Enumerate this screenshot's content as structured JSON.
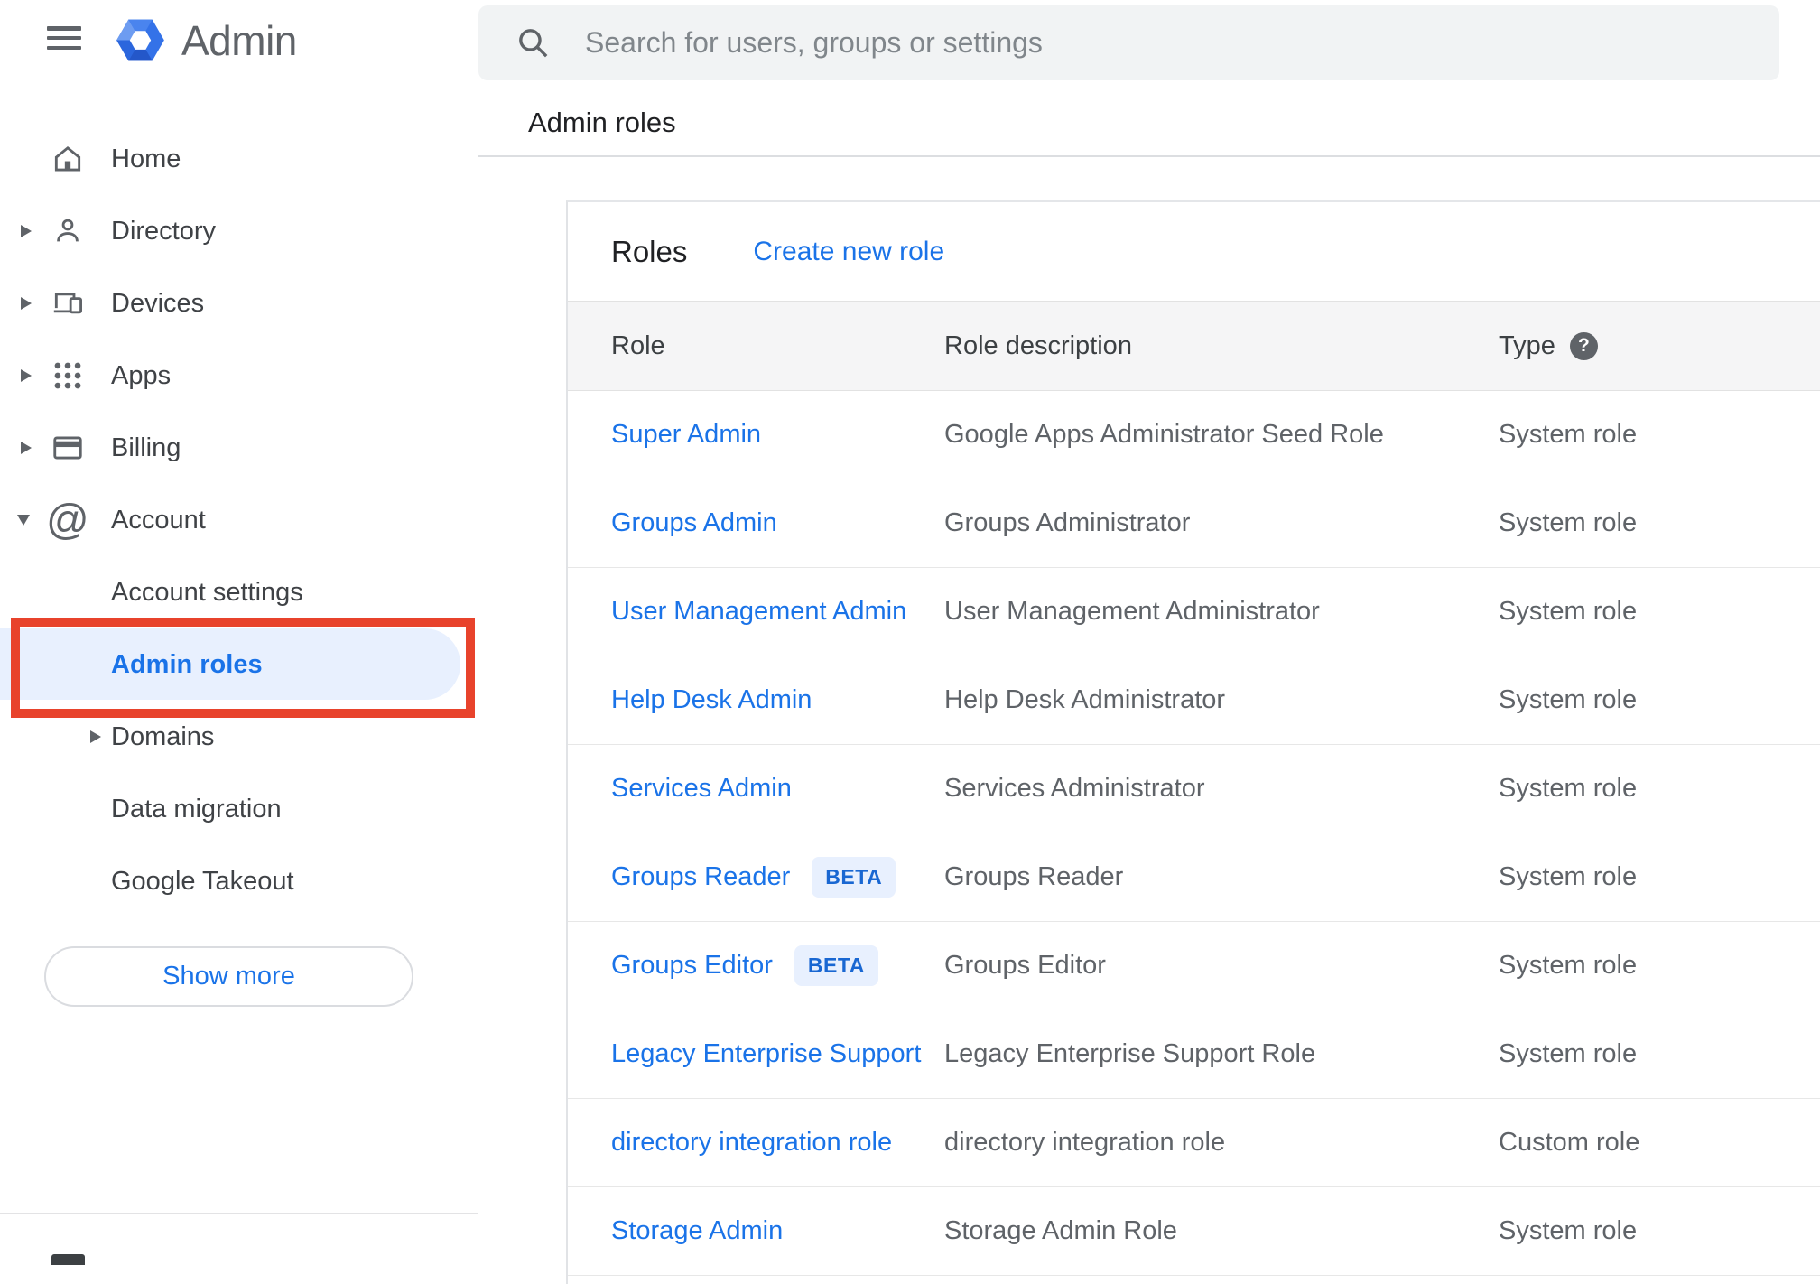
{
  "app": {
    "logo_text": "Admin"
  },
  "search": {
    "placeholder": "Search for users, groups or settings"
  },
  "breadcrumb": {
    "label": "Admin roles"
  },
  "sidebar": {
    "items": [
      {
        "label": "Home"
      },
      {
        "label": "Directory"
      },
      {
        "label": "Devices"
      },
      {
        "label": "Apps"
      },
      {
        "label": "Billing"
      },
      {
        "label": "Account"
      },
      {
        "label": "Account settings"
      },
      {
        "label": "Admin roles",
        "selected": true
      },
      {
        "label": "Domains"
      },
      {
        "label": "Data migration"
      },
      {
        "label": "Google Takeout"
      }
    ],
    "show_more_label": "Show more"
  },
  "main": {
    "card_title": "Roles",
    "create_link": "Create new role",
    "table": {
      "columns": [
        "Role",
        "Role description",
        "Type"
      ],
      "help_glyph": "?",
      "rows": [
        {
          "role": "Super Admin",
          "description": "Google Apps Administrator Seed Role",
          "type": "System role"
        },
        {
          "role": "Groups Admin",
          "description": "Groups Administrator",
          "type": "System role"
        },
        {
          "role": "User Management Admin",
          "description": "User Management Administrator",
          "type": "System role"
        },
        {
          "role": "Help Desk Admin",
          "description": "Help Desk Administrator",
          "type": "System role"
        },
        {
          "role": "Services Admin",
          "description": "Services Administrator",
          "type": "System role"
        },
        {
          "role": "Groups Reader",
          "badge": "BETA",
          "description": "Groups Reader",
          "type": "System role"
        },
        {
          "role": "Groups Editor",
          "badge": "BETA",
          "description": "Groups Editor",
          "type": "System role"
        },
        {
          "role": "Legacy Enterprise Support",
          "description": "Legacy Enterprise Support Role",
          "type": "System role"
        },
        {
          "role": "directory integration role",
          "description": "directory integration role",
          "type": "Custom role"
        },
        {
          "role": "Storage Admin",
          "description": "Storage Admin Role",
          "type": "System role"
        }
      ]
    }
  },
  "colors": {
    "accent_blue": "#1a73e8",
    "selected_pill_bg": "#e8f0fe",
    "annotation_red": "#e8432c",
    "header_band_bg": "#f5f5f6",
    "search_bg": "#f1f3f4"
  }
}
